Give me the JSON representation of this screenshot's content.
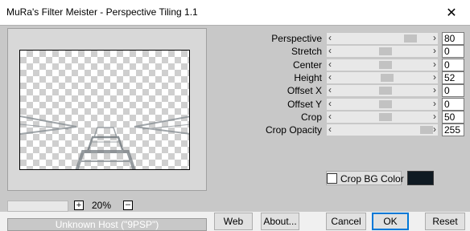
{
  "window": {
    "title": "MuRa's Filter Meister - Perspective Tiling 1.1",
    "close_glyph": "✕"
  },
  "preview": {
    "zoom_plus": "+",
    "zoom_value": "20%",
    "zoom_minus": "–",
    "host_text": "Unknown Host (\"9PSP\")"
  },
  "params": [
    {
      "label": "Perspective",
      "value": "80",
      "level": 0.8
    },
    {
      "label": "Stretch",
      "value": "0",
      "level": 0.5
    },
    {
      "label": "Center",
      "value": "0",
      "level": 0.5
    },
    {
      "label": "Height",
      "value": "52",
      "level": 0.52
    },
    {
      "label": "Offset X",
      "value": "0",
      "level": 0.5
    },
    {
      "label": "Offset Y",
      "value": "0",
      "level": 0.5
    },
    {
      "label": "Crop",
      "value": "50",
      "level": 0.5
    },
    {
      "label": "Crop Opacity",
      "value": "255",
      "level": 1.0
    }
  ],
  "crop_bg": {
    "label": "Crop BG Color",
    "checked": false,
    "color": "#0f1a22"
  },
  "buttons": {
    "web": "Web",
    "about": "About...",
    "cancel": "Cancel",
    "ok": "OK",
    "reset": "Reset"
  },
  "colors": {
    "client_bg": "#c8c8c8",
    "default_button_border": "#0078d7"
  }
}
